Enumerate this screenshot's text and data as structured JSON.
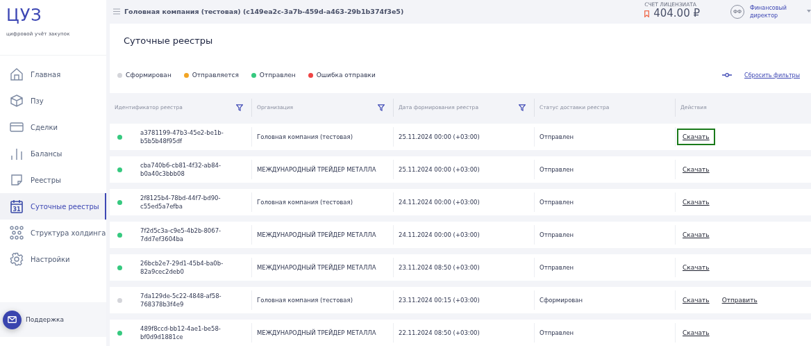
{
  "logo": {
    "title": "ЦУЗ",
    "subtitle": "цифровой учёт закупок"
  },
  "sidebar": {
    "items": [
      {
        "label": "Главная",
        "selected": false
      },
      {
        "label": "Пзу",
        "selected": false
      },
      {
        "label": "Сделки",
        "selected": false
      },
      {
        "label": "Балансы",
        "selected": false
      },
      {
        "label": "Реестры",
        "selected": false
      },
      {
        "label": "Суточные реестры",
        "selected": true,
        "icon_text": "31"
      },
      {
        "label": "Структура холдинга",
        "selected": false
      },
      {
        "label": "Настройки",
        "selected": false
      }
    ],
    "support": "Поддержка"
  },
  "header": {
    "company": "Головная компания (тестовая) (c149ea2c-3a7b-459d-a463-29b1b374f3e5)",
    "account_label": "СЧЕТ ЛИЦЕНЗИАТА",
    "balance": "404.00 ₽",
    "avatar": "ФФ",
    "role": "Финансовый директор"
  },
  "page": {
    "title": "Суточные реестры",
    "legend": [
      {
        "label": "Сформирован",
        "color": "#d4d5da"
      },
      {
        "label": "Отправляется",
        "color": "#f2a524"
      },
      {
        "label": "Отправлен",
        "color": "#36c97f"
      },
      {
        "label": "Ошибка отправки",
        "color": "#ef4444"
      }
    ],
    "reset_filters": "Сбросить фильтры"
  },
  "table": {
    "columns": [
      {
        "label": "Идентификатор реестра",
        "filter": true
      },
      {
        "label": "Организация",
        "filter": true
      },
      {
        "label": "Дата формирования реестра",
        "filter": true
      },
      {
        "label": "Статус доставки реестра",
        "filter": false
      },
      {
        "label": "Действия",
        "filter": false
      }
    ],
    "rows": [
      {
        "color": "#36c97f",
        "id": "a3781199-47b3-45e2-be1b-b5b5b48f95df",
        "org": "Головная компания (тестовая)",
        "date": "25.11.2024 00:00 (+03:00)",
        "status": "Отправлен",
        "actions": [
          {
            "label": "Скачать",
            "focused": true
          }
        ]
      },
      {
        "color": "#36c97f",
        "id": "cba740b6-cb81-4f32-ab84-b0a40c3bbb08",
        "org": "МЕЖДУНАРОДНЫЙ ТРЕЙДЕР МЕТАЛЛА",
        "date": "25.11.2024 00:00 (+03:00)",
        "status": "Отправлен",
        "actions": [
          {
            "label": "Скачать",
            "focused": false
          }
        ]
      },
      {
        "color": "#36c97f",
        "id": "2f8125b4-78bd-44f7-bd90-c55ed5a7efba",
        "org": "Головная компания (тестовая)",
        "date": "24.11.2024 00:00 (+03:00)",
        "status": "Отправлен",
        "actions": [
          {
            "label": "Скачать",
            "focused": false
          }
        ]
      },
      {
        "color": "#36c97f",
        "id": "7f2d5c3a-c9e5-4b2b-8067-7dd7ef3604ba",
        "org": "МЕЖДУНАРОДНЫЙ ТРЕЙДЕР МЕТАЛЛА",
        "date": "24.11.2024 00:00 (+03:00)",
        "status": "Отправлен",
        "actions": [
          {
            "label": "Скачать",
            "focused": false
          }
        ]
      },
      {
        "color": "#36c97f",
        "id": "26bcb2e7-29d1-45b4-ba0b-82a9cec2deb0",
        "org": "МЕЖДУНАРОДНЫЙ ТРЕЙДЕР МЕТАЛЛА",
        "date": "23.11.2024 08:50 (+03:00)",
        "status": "Отправлен",
        "actions": [
          {
            "label": "Скачать",
            "focused": false
          }
        ]
      },
      {
        "color": "#d4d5da",
        "id": "7da129de-5c22-4848-af58-768378b3f4e9",
        "org": "Головная компания (тестовая)",
        "date": "23.11.2024 00:15 (+03:00)",
        "status": "Сформирован",
        "actions": [
          {
            "label": "Скачать",
            "focused": false
          },
          {
            "label": "Отправить",
            "focused": false
          }
        ]
      },
      {
        "color": "#36c97f",
        "id": "489f8ccd-bb12-4ae1-be58-bf0d9d1881ce",
        "org": "МЕЖДУНАРОДНЫЙ ТРЕЙДЕР МЕТАЛЛА",
        "date": "22.11.2024 08:50 (+03:00)",
        "status": "Отправлен",
        "actions": [
          {
            "label": "Скачать",
            "focused": false
          }
        ]
      }
    ]
  }
}
